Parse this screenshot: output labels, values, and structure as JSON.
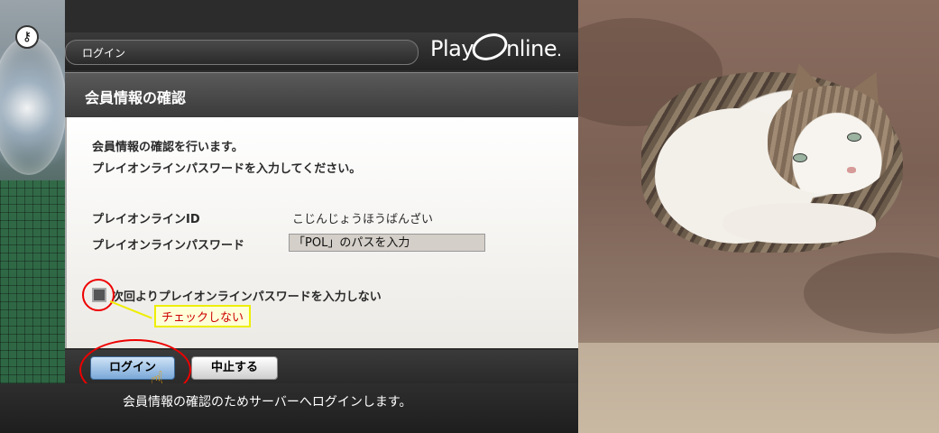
{
  "header": {
    "breadcrumb": "ログイン",
    "logo_text_left": "Play",
    "logo_text_right": "nline",
    "logo_mark": "."
  },
  "page": {
    "title": "会員情報の確認",
    "intro_line1": "会員情報の確認を行います。",
    "intro_line2": "プレイオンラインパスワードを入力してください。"
  },
  "form": {
    "id_label": "プレイオンラインID",
    "id_value": "こじんじょうほうばんざい",
    "password_label": "プレイオンラインパスワード",
    "password_value": "「POL」のパスを入力",
    "remember_label": "次回よりプレイオンラインパスワードを入力しない",
    "remember_checked": false
  },
  "annotation": {
    "checkbox_note": "チェックしない",
    "circle_color": "#e00000",
    "note_color": "#cc0000",
    "note_border": "#eeee00"
  },
  "buttons": {
    "login": "ログイン",
    "cancel": "中止する"
  },
  "status": {
    "message": "会員情報の確認のためサーバーへログインします。"
  },
  "icons": {
    "help": "help-key-icon",
    "cursor": "pointer-hand-icon"
  },
  "photo": {
    "subject": "cat-photo"
  }
}
